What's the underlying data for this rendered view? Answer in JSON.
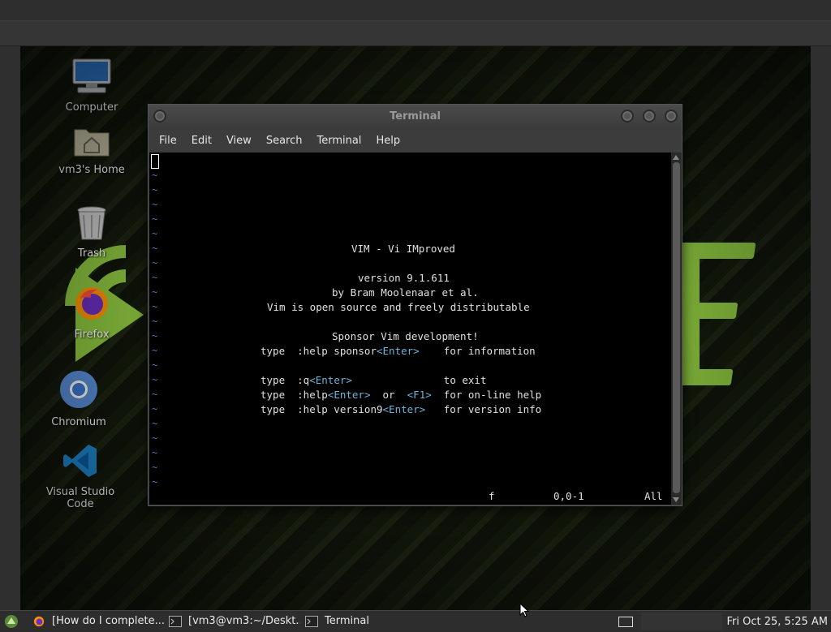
{
  "desktop": {
    "icons": [
      {
        "label": "Computer",
        "icon": "computer-icon"
      },
      {
        "label": "vm3's Home",
        "icon": "home-folder-icon"
      },
      {
        "label": "Trash",
        "icon": "trash-icon"
      },
      {
        "label": "Firefox",
        "icon": "firefox-icon"
      },
      {
        "label": "Chromium",
        "icon": "chromium-icon"
      },
      {
        "label": "Visual Studio Code",
        "icon": "vscode-icon"
      }
    ]
  },
  "terminal": {
    "title": "Terminal",
    "menu": [
      "File",
      "Edit",
      "View",
      "Search",
      "Terminal",
      "Help"
    ],
    "vim": {
      "heading": "VIM - Vi IMproved",
      "version": "version 9.1.611",
      "author": "by Bram Moolenaar et al.",
      "license": "Vim is open source and freely distributable",
      "sponsor_heading": "Sponsor Vim development!",
      "lines": [
        {
          "prefix": "type  :help sponsor",
          "key": "<Enter>",
          "mid": "    ",
          "key2": "",
          "suffix": "for information"
        },
        {
          "prefix": "type  :q",
          "key": "<Enter>",
          "mid": "               ",
          "key2": "",
          "suffix": "to exit"
        },
        {
          "prefix": "type  :help",
          "key": "<Enter>",
          "mid": "  or  ",
          "key2": "<F1>",
          "suffix": "  for on-line help"
        },
        {
          "prefix": "type  :help version9",
          "key": "<Enter>",
          "mid": "   ",
          "key2": "",
          "suffix": "for version info"
        }
      ],
      "status_f": "f",
      "status_pos": "0,0-1",
      "status_all": "All"
    }
  },
  "taskbar": {
    "tasks": [
      {
        "label": "[How do I complete...",
        "icon": "firefox-icon"
      },
      {
        "label": "[vm3@vm3:~/Deskt...",
        "icon": "terminal-icon"
      },
      {
        "label": "Terminal",
        "icon": "terminal-icon"
      }
    ],
    "clock": "Fri Oct 25,  5:25 AM"
  },
  "colors": {
    "accent_green": "#8dc63f",
    "vim_key": "#6fb3d8",
    "vim_tilde": "#5a6fb8"
  }
}
